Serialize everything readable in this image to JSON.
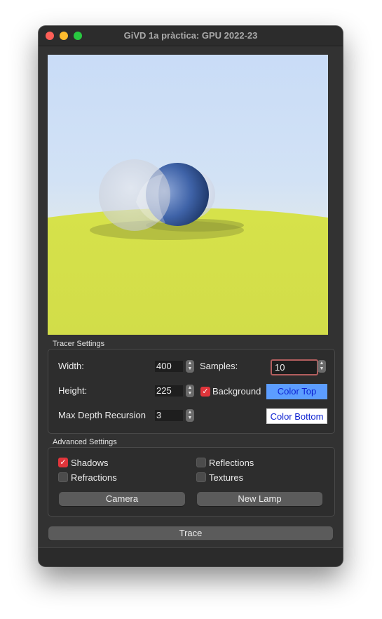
{
  "window": {
    "title": "GiVD 1a pràctica: GPU 2022-23"
  },
  "tracer": {
    "group_title": "Tracer Settings",
    "width_label": "Width:",
    "width_value": "400",
    "height_label": "Height:",
    "height_value": "225",
    "depth_label": "Max Depth Recursion",
    "depth_value": "3",
    "samples_label": "Samples:",
    "samples_value": "10",
    "background_label": "Background",
    "background_checked": true,
    "color_top_label": "Color Top",
    "color_bottom_label": "Color Bottom"
  },
  "advanced": {
    "group_title": "Advanced Settings",
    "shadows_label": "Shadows",
    "shadows_checked": true,
    "reflections_label": "Reflections",
    "reflections_checked": false,
    "refractions_label": "Refractions",
    "refractions_checked": false,
    "textures_label": "Textures",
    "textures_checked": false,
    "camera_label": "Camera",
    "new_lamp_label": "New Lamp"
  },
  "trace_label": "Trace",
  "colors": {
    "color_top_bg": "#5c9dff",
    "color_top_text": "#0a1fd1",
    "color_bottom_bg": "#ffffff",
    "color_bottom_text": "#0a1fd1",
    "checkbox_accent": "#e0353b",
    "ground": "#d8e449"
  }
}
